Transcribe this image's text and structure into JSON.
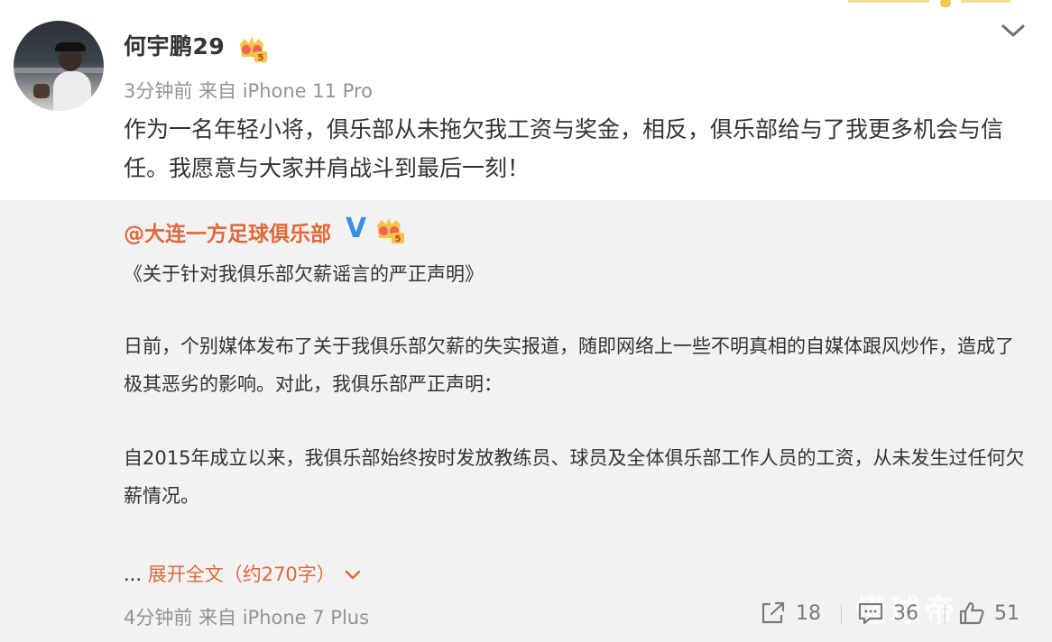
{
  "post": {
    "username": "何宇鹏29",
    "badge_level": "5",
    "meta": "3分钟前  来自 iPhone 11 Pro",
    "content": "作为一名年轻小将，俱乐部从未拖欠我工资与奖金，相反，俱乐部给与了我更多机会与信任。我愿意与大家并肩战斗到最后一刻！",
    "menu_icon": "chevron-down-icon"
  },
  "repost": {
    "author": "@大连一方足球俱乐部",
    "verified_mark": "V",
    "badge_level": "5",
    "title": "《关于针对我俱乐部欠薪谣言的严正声明》",
    "paragraph1": "日前，个别媒体发布了关于我俱乐部欠薪的失实报道，随即网络上一些不明真相的自媒体跟风炒作，造成了极其恶劣的影响。对此，我俱乐部严正声明：",
    "paragraph2": "自2015年成立以来，我俱乐部始终按时发放教练员、球员及全体俱乐部工作人员的工资，从未发生过任何欠薪情况。",
    "expand_prefix": "... ",
    "expand_label": "展开全文（约270字）",
    "meta": "4分钟前  来自 iPhone 7 Plus",
    "actions": {
      "share_count": "18",
      "comment_count": "36",
      "like_count": "51"
    },
    "watermark": "懂球帝"
  },
  "colors": {
    "accent_orange": "#e0683a",
    "verified_blue": "#3a8ee6",
    "meta_gray": "#939393",
    "repost_bg": "#f2f2f2"
  }
}
